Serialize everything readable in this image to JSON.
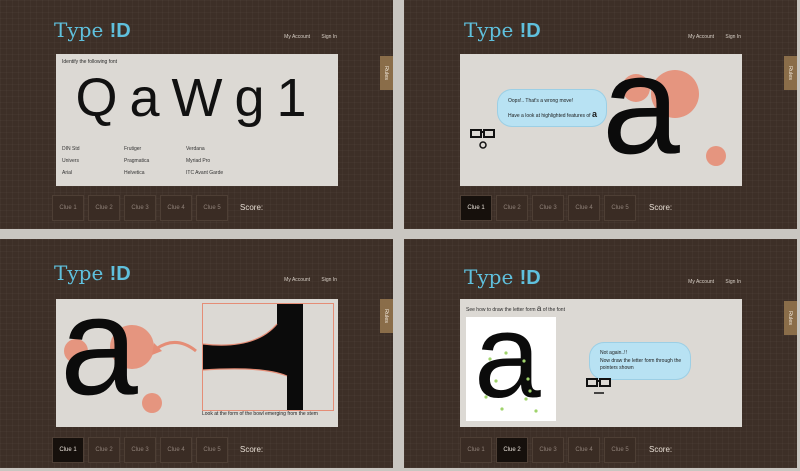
{
  "app": {
    "logo_text": "Type ",
    "logo_id": "!D"
  },
  "toplinks": [
    "My Account",
    "Sign In"
  ],
  "rules_label": "Rules",
  "score_label": "Score:",
  "clues": [
    "Clue 1",
    "Clue 2",
    "Clue 3",
    "Clue 4",
    "Clue 5"
  ],
  "screen1": {
    "prompt": "Identify the following font",
    "sample": "QaWg1",
    "options": [
      "DIN Std",
      "Univers",
      "Arial",
      "Frutiger",
      "Pragmatica",
      "Helvetica",
      "Verdana",
      "Myriad Pro",
      "ITC Avant Garde"
    ]
  },
  "screen2": {
    "bubble_line1": "Oops!.. That's a wrong move!",
    "bubble_line2": "Have a look at highlighted features of",
    "bubble_glyph": "a",
    "big_glyph": "a",
    "active_clue": 0
  },
  "screen3": {
    "big_glyph": "a",
    "caption": "Look at the form of the bowl emerging from the stem",
    "active_clue": 0
  },
  "screen4": {
    "prompt_before": "See how to draw the letter form",
    "prompt_glyph": "a",
    "prompt_after": "of the font",
    "draw_glyph": "a",
    "bubble_line1": "Not again..!!",
    "bubble_line2": "Now draw the letter form through the pointers shown",
    "active_clue": 1
  },
  "colors": {
    "logo": "#5fc0dd",
    "background": "#3d2f27",
    "card": "#dcd9d4",
    "highlight": "#e58d76",
    "bubble": "#b8e2f3"
  }
}
